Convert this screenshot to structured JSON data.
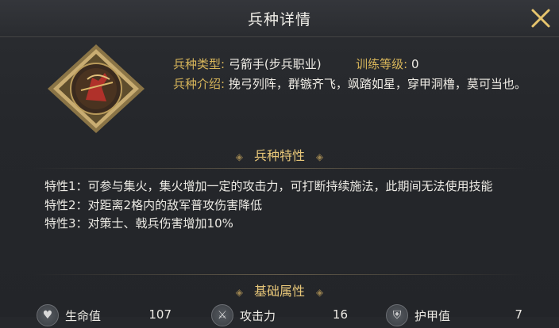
{
  "header": {
    "title": "兵种详情"
  },
  "unit": {
    "type_label": "兵种类型:",
    "type_value": "弓箭手(步兵职业)",
    "level_label": "训练等级:",
    "level_value": "0",
    "intro_label": "兵种介绍:",
    "intro_value": "挽弓列阵，群镞齐飞，飒踏如星，穿甲洞橹，莫可当也。"
  },
  "features": {
    "title": "兵种特性",
    "items": [
      "特性1：可参与集火，集火增加一定的攻击力，可打断持续施法，此期间无法使用技能",
      "特性2：对距离2格内的敌军普攻伤害降低",
      "特性3：对策士、戟兵伤害增加10%"
    ]
  },
  "attributes": {
    "title": "基础属性",
    "stats": [
      {
        "icon": "heart-icon",
        "name": "生命值",
        "value": "107"
      },
      {
        "icon": "sword-icon",
        "name": "攻击力",
        "value": "16"
      },
      {
        "icon": "shield-icon",
        "name": "护甲值",
        "value": "7"
      }
    ]
  },
  "colors": {
    "accent": "#d7b55a",
    "heading": "#e8c779",
    "background": "#26282c"
  }
}
